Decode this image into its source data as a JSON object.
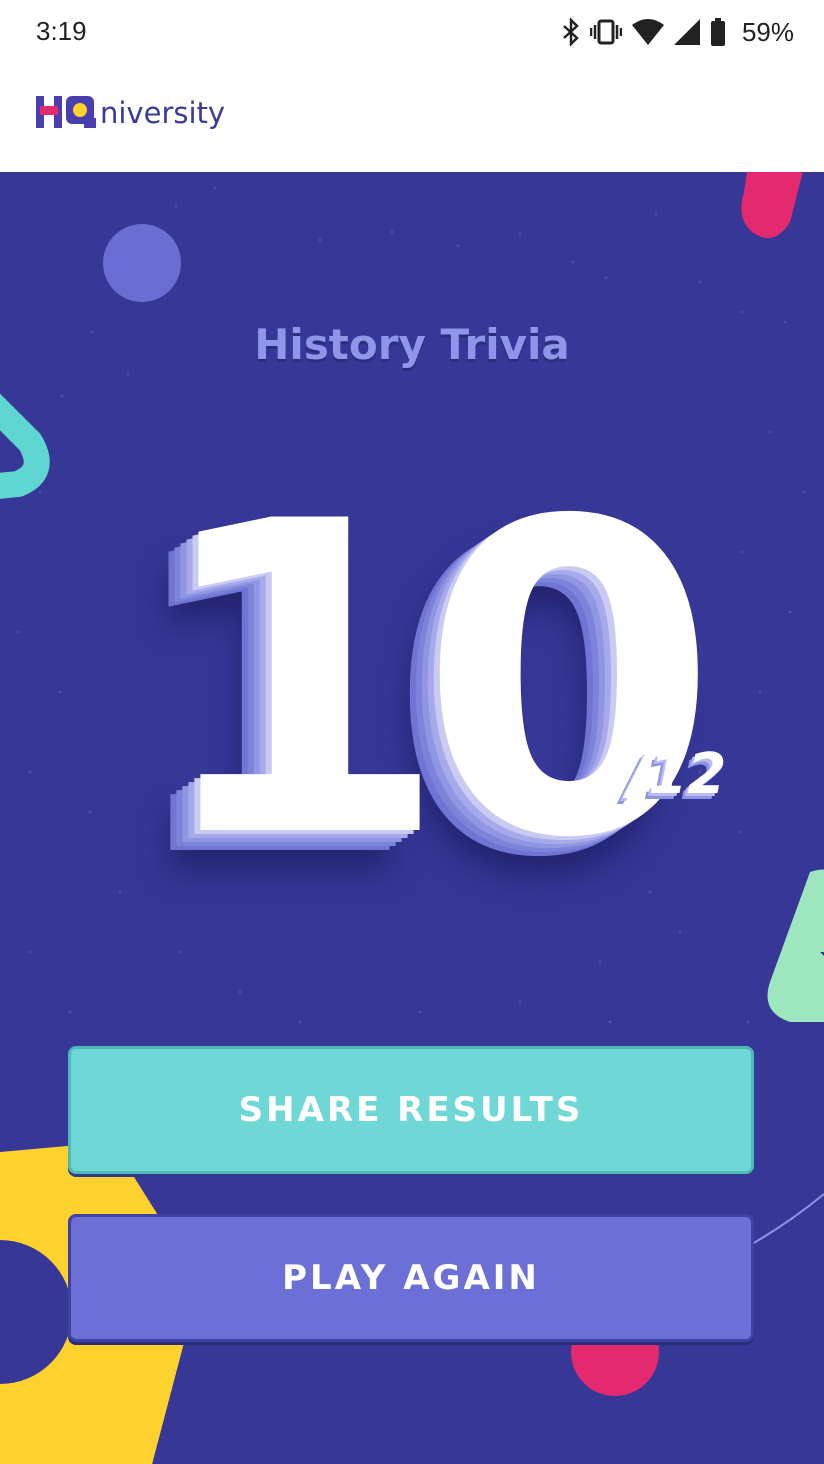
{
  "status_bar": {
    "time": "3:19",
    "battery_percent": "59%",
    "icons": [
      "bluetooth-icon",
      "vibrate-icon",
      "wifi-icon",
      "cell-signal-icon",
      "battery-icon"
    ]
  },
  "header": {
    "logo_text": "niversity",
    "logo_mark": "HQ"
  },
  "quiz": {
    "title": "History Trivia",
    "score": "10",
    "total": "/12",
    "score_value": 10,
    "total_value": 12
  },
  "actions": {
    "share_label": "SHARE RESULTS",
    "play_again_label": "PLAY AGAIN"
  },
  "colors": {
    "background": "#363797",
    "share_button": "#6fd8d6",
    "play_button": "#6b6fd6",
    "title": "#8f95e8",
    "accent_pink": "#e5296e",
    "accent_yellow": "#fdd22f",
    "accent_teal": "#5fd6cf",
    "accent_green": "#9ee6be"
  }
}
